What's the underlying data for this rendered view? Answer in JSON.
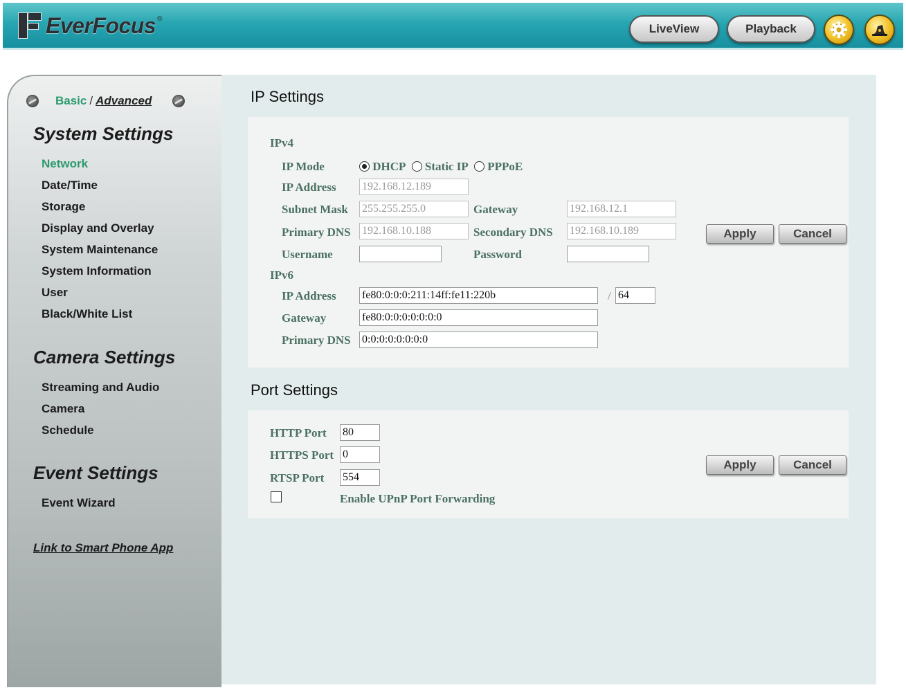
{
  "header": {
    "brand": "EverFocus",
    "brand_reg": "®",
    "liveview_label": "LiveView",
    "playback_label": "Playback",
    "accent_color": "#27a6b2"
  },
  "sidebar": {
    "mode_basic": "Basic",
    "mode_sep": "/",
    "mode_advanced": "Advanced",
    "system_heading": "System Settings",
    "system_items": [
      "Network",
      "Date/Time",
      "Storage",
      "Display and Overlay",
      "System Maintenance",
      "System Information",
      "User",
      "Black/White List"
    ],
    "camera_heading": "Camera Settings",
    "camera_items": [
      "Streaming and Audio",
      "Camera",
      "Schedule"
    ],
    "event_heading": "Event Settings",
    "event_items": [
      "Event Wizard"
    ],
    "smartphone_link": "Link to Smart Phone App",
    "active_color": "#2d9a6e"
  },
  "ip_settings": {
    "title": "IP Settings",
    "ipv4_label": "IPv4",
    "ip_mode_label": "IP Mode",
    "ip_mode_options": [
      "DHCP",
      "Static IP",
      "PPPoE"
    ],
    "ip_mode_selected": "DHCP",
    "ip_address_label": "IP Address",
    "ip_address": "192.168.12.189",
    "subnet_label": "Subnet Mask",
    "subnet": "255.255.255.0",
    "gateway_label": "Gateway",
    "gateway": "192.168.12.1",
    "primary_dns_label": "Primary DNS",
    "primary_dns": "192.168.10.188",
    "secondary_dns_label": "Secondary DNS",
    "secondary_dns": "192.168.10.189",
    "username_label": "Username",
    "username": "",
    "password_label": "Password",
    "password": "",
    "ipv6_label": "IPv6",
    "ipv6_address_label": "IP Address",
    "ipv6_address": "fe80:0:0:0:211:14ff:fe11:220b",
    "ipv6_prefix_sep": "/",
    "ipv6_prefix": "64",
    "ipv6_gateway_label": "Gateway",
    "ipv6_gateway": "fe80:0:0:0:0:0:0:0",
    "ipv6_dns_label": "Primary DNS",
    "ipv6_dns": "0:0:0:0:0:0:0:0",
    "apply_label": "Apply",
    "cancel_label": "Cancel"
  },
  "port_settings": {
    "title": "Port Settings",
    "http_label": "HTTP Port",
    "http": "80",
    "https_label": "HTTPS Port",
    "https": "0",
    "rtsp_label": "RTSP Port",
    "rtsp": "554",
    "upnp_label": "Enable UPnP Port Forwarding",
    "upnp_checked": false,
    "apply_label": "Apply",
    "cancel_label": "Cancel"
  }
}
